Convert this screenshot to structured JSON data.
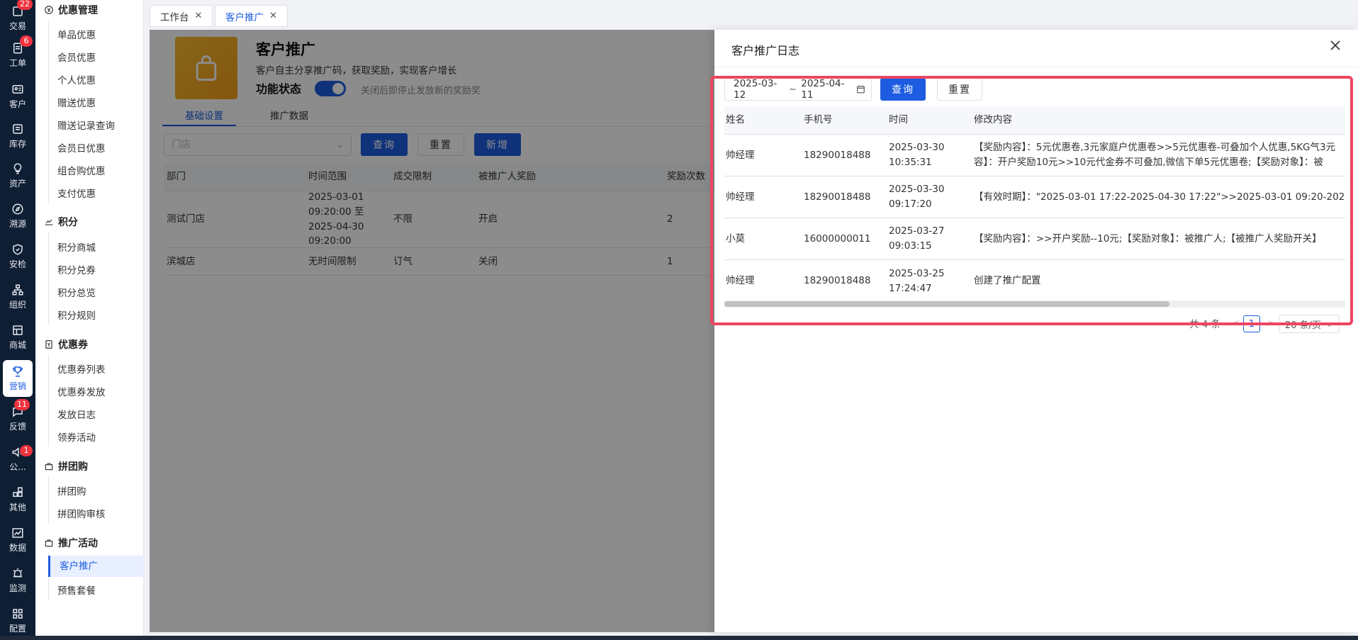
{
  "rail": {
    "items": [
      {
        "label": "交易",
        "badge": "22",
        "icon": "exchange-icon"
      },
      {
        "label": "工单",
        "badge": "6",
        "icon": "ticket-icon"
      },
      {
        "label": "客户",
        "badge": "",
        "icon": "customer-icon"
      },
      {
        "label": "库存",
        "badge": "",
        "icon": "inventory-icon"
      },
      {
        "label": "资产",
        "badge": "",
        "icon": "bulb-icon"
      },
      {
        "label": "溯源",
        "badge": "",
        "icon": "compass-icon"
      },
      {
        "label": "安检",
        "badge": "",
        "icon": "shield-icon"
      },
      {
        "label": "组织",
        "badge": "",
        "icon": "org-icon"
      },
      {
        "label": "商城",
        "badge": "",
        "icon": "store-icon"
      },
      {
        "label": "营销",
        "badge": "",
        "icon": "trophy-icon"
      },
      {
        "label": "反馈",
        "badge": "11",
        "icon": "feedback-icon"
      },
      {
        "label": "公...",
        "badge": "1",
        "icon": "megaphone-icon"
      },
      {
        "label": "其他",
        "badge": "",
        "icon": "grid-plus-icon"
      },
      {
        "label": "数据",
        "badge": "",
        "icon": "chart-icon"
      },
      {
        "label": "监测",
        "badge": "",
        "icon": "alarm-icon"
      },
      {
        "label": "配置",
        "badge": "",
        "icon": "apps-icon"
      }
    ]
  },
  "menu": {
    "groups": [
      {
        "title": "优惠管理",
        "items": [
          "单品优惠",
          "会员优惠",
          "个人优惠",
          "赠送优惠",
          "赠送记录查询",
          "会员日优惠",
          "组合购优惠",
          "支付优惠"
        ]
      },
      {
        "title": "积分",
        "items": [
          "积分商城",
          "积分兑券",
          "积分总览",
          "积分规则"
        ]
      },
      {
        "title": "优惠券",
        "items": [
          "优惠券列表",
          "优惠券发放",
          "发放日志",
          "领券活动"
        ]
      },
      {
        "title": "拼团购",
        "items": [
          "拼团购",
          "拼团购审核"
        ]
      },
      {
        "title": "推广活动",
        "items": [
          "客户推广",
          "预售套餐"
        ]
      }
    ]
  },
  "tabs": [
    {
      "label": "工作台"
    },
    {
      "label": "客户推广"
    }
  ],
  "page": {
    "title": "客户推广",
    "desc": "客户自主分享推广码，获取奖励，实现客户增长",
    "func_label": "功能状态",
    "func_hint": "关闭后即停止发放新的奖励奖",
    "subtabs": [
      "基础设置",
      "推广数据"
    ],
    "store_placeholder": "门店",
    "query_label": "查询",
    "reset_label": "重置",
    "add_label": "新增",
    "table": {
      "headers": [
        "部门",
        "时间范围",
        "成交限制",
        "被推广人奖励",
        "奖励次数"
      ],
      "rows": [
        [
          "测试门店",
          "2025-03-01 09:20:00 至 2025-04-30 09:20:00",
          "不限",
          "开启",
          "2"
        ],
        [
          "滨城店",
          "无时间限制",
          "订气",
          "关闭",
          "1"
        ]
      ]
    }
  },
  "drawer": {
    "title": "客户推广日志",
    "date_start": "2025-03-12",
    "date_sep": "~",
    "date_end": "2025-04-11",
    "query_label": "查询",
    "reset_label": "重置",
    "headers": [
      "姓名",
      "手机号",
      "时间",
      "修改内容"
    ],
    "rows": [
      {
        "name": "帅经理",
        "phone": "18290018488",
        "date": "2025-03-30",
        "time": "10:35:31",
        "content1": "【奖励内容】：5元优惠卷,3元家庭户优惠卷>>5元优惠卷-可叠加个人优惠,5KG气3元",
        "content2": "容】：开户奖励10元>>10元代金券不可叠加,微信下单5元优惠卷;【奖励对象】：被"
      },
      {
        "name": "帅经理",
        "phone": "18290018488",
        "date": "2025-03-30",
        "time": "09:17:20",
        "content1": "【有效时期】：\"2025-03-01 17:22-2025-04-30 17:22\">>2025-03-01 09:20-2025-04",
        "content2": ""
      },
      {
        "name": "小莫",
        "phone": "16000000011",
        "date": "2025-03-27",
        "time": "09:03:15",
        "content1": "【奖励内容】：>>开户奖励--10元;【奖励对象】：被推广人;【被推广人奖励开关】",
        "content2": ""
      },
      {
        "name": "帅经理",
        "phone": "18290018488",
        "date": "2025-03-25",
        "time": "17:24:47",
        "content1": "创建了推广配置",
        "content2": ""
      }
    ],
    "pagination": {
      "total": "共 4 条",
      "prev": "<",
      "current": "1",
      "next": ">",
      "size": "20 条/页"
    }
  }
}
